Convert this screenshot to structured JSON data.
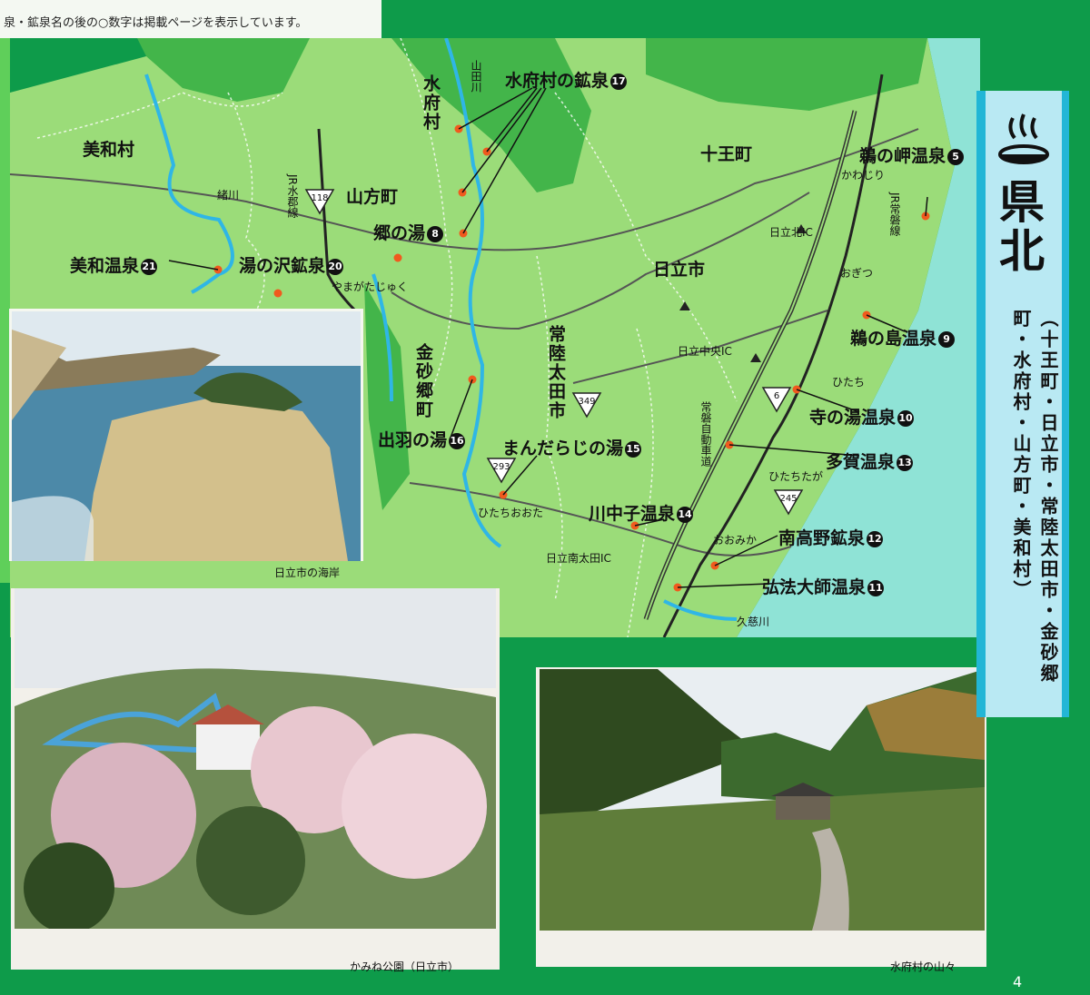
{
  "header_note": "泉・鉱泉名の後の○数字は掲載ページを表示しています。",
  "page_number": "4",
  "side_panel": {
    "title": "県北",
    "areas": "（十王町・日立市・常陸太田市・金砂郷町・水府村・山方町・美和村）"
  },
  "region_labels": {
    "miwa": "美和村",
    "suifu": "水府村",
    "yamagata": "山方町",
    "juo": "十王町",
    "hitachi": "日立市",
    "hitachiota": "常陸太田市",
    "kanasago": "金砂郷町"
  },
  "rail_labels": {
    "suigun": "JR水郡線",
    "joban": "JR常磐線"
  },
  "river_labels": {
    "yamada": "山田川",
    "ogawa": "緒川",
    "kuji": "久慈川"
  },
  "road_labels": {
    "expressway": "常磐自動車道",
    "hitachi_kita_ic": "日立北IC",
    "hitachi_chuo_ic": "日立中央IC",
    "hitachi_minami_ota_ic": "日立南太田IC"
  },
  "route_numbers": [
    "118",
    "349",
    "293",
    "6",
    "245"
  ],
  "stations": {
    "kawajiri": "かわじり",
    "ogitsu": "おぎつ",
    "hitachi": "ひたち",
    "hitachitaga": "ひたちたが",
    "omika": "おおみか",
    "hitachiota": "ひたちおおた",
    "yamagatajuku": "やまがたじゅく"
  },
  "onsen": [
    {
      "name": "水府村の鉱泉",
      "page": "17"
    },
    {
      "name": "鵜の岬温泉",
      "page": "5"
    },
    {
      "name": "郷の湯",
      "page": "8"
    },
    {
      "name": "美和温泉",
      "page": "21"
    },
    {
      "name": "湯の沢鉱泉",
      "page": "20"
    },
    {
      "name": "鵜の島温泉",
      "page": "9"
    },
    {
      "name": "寺の湯温泉",
      "page": "10"
    },
    {
      "name": "出羽の湯",
      "page": "16"
    },
    {
      "name": "まんだらじの湯",
      "page": "15"
    },
    {
      "name": "多賀温泉",
      "page": "13"
    },
    {
      "name": "川中子温泉",
      "page": "14"
    },
    {
      "name": "南高野鉱泉",
      "page": "12"
    },
    {
      "name": "弘法大師温泉",
      "page": "11"
    }
  ],
  "captions": {
    "coast": "日立市の海岸",
    "kamine": "かみね公園（日立市）",
    "suifu_mountains": "水府村の山々"
  },
  "colors": {
    "land": "#9bdc79",
    "land_dark": "#43b54a",
    "sea": "#8fe3d6",
    "river": "#2fb6e6",
    "onsen_dot": "#f05a1e",
    "panel": "#22b6d6"
  }
}
